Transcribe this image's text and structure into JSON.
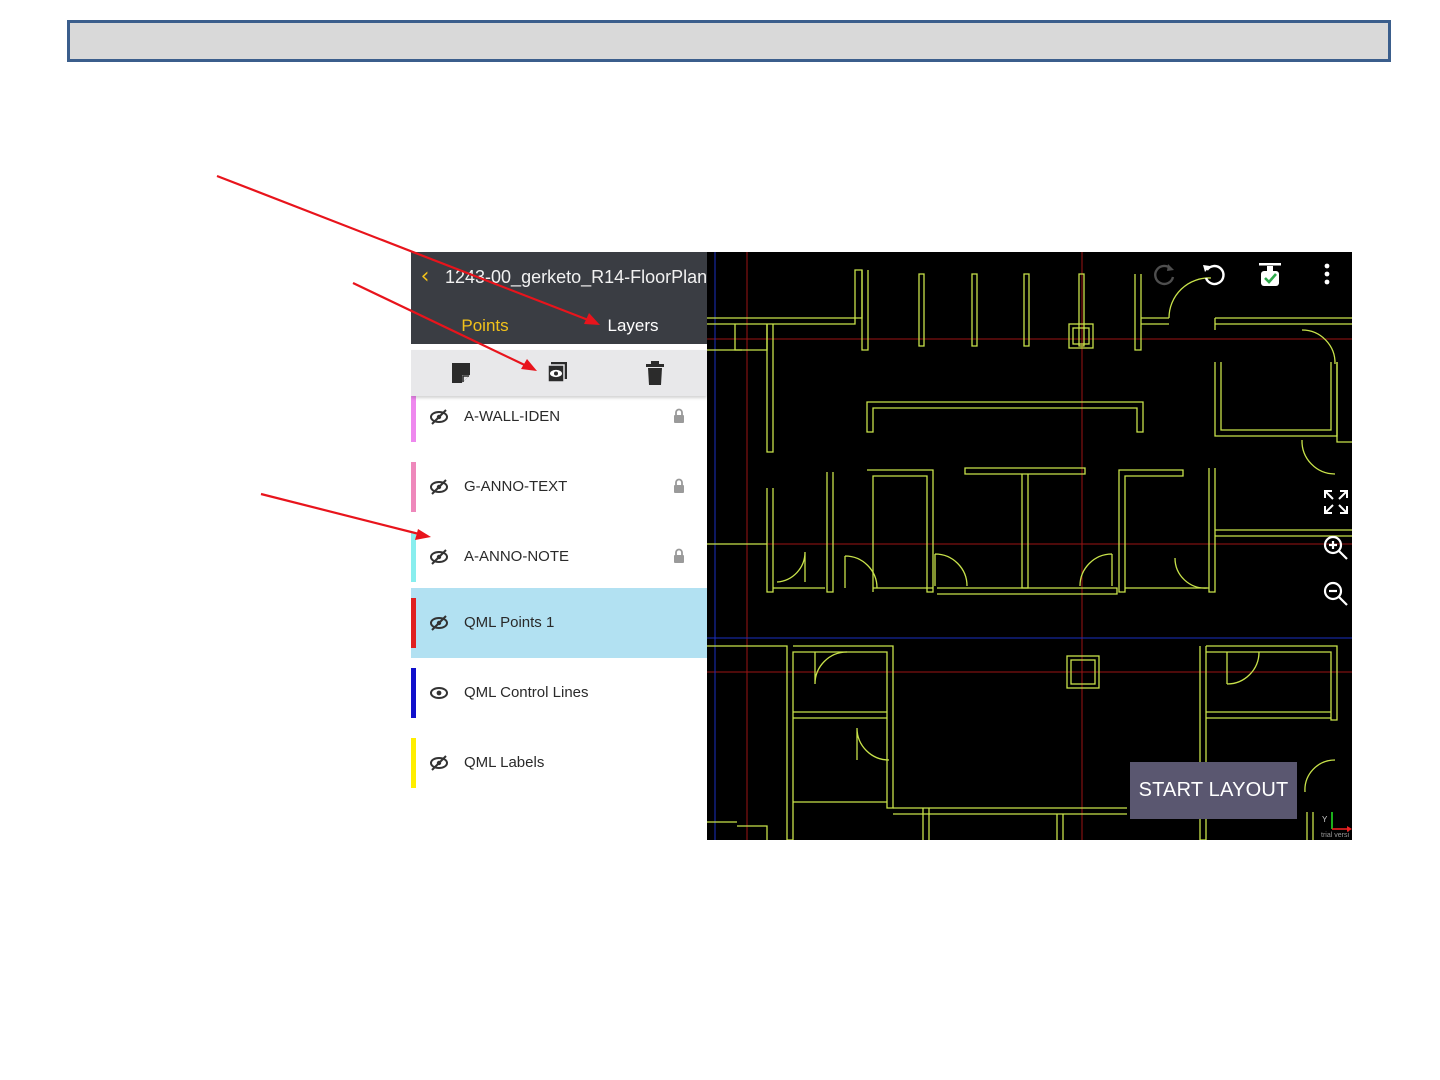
{
  "app": {
    "file_title": "1243-00_gerketo_R14-FloorPlan",
    "back_icon": "chevron-left-icon"
  },
  "tabs": [
    {
      "label": "Points",
      "active": false
    },
    {
      "label": "Layers",
      "active": true
    }
  ],
  "toolbar": {
    "buttons": [
      {
        "icon": "note-icon"
      },
      {
        "icon": "visibility-toggle-icon"
      },
      {
        "icon": "trash-icon"
      }
    ]
  },
  "layers": [
    {
      "name": "",
      "color": "#ffee00",
      "visible": false,
      "locked": true
    },
    {
      "name": "A-WALL-IDEN",
      "color": "#ee88ee",
      "visible": false,
      "locked": true
    },
    {
      "name": "G-ANNO-TEXT",
      "color": "#ee88bb",
      "visible": false,
      "locked": true
    },
    {
      "name": "A-ANNO-NOTE",
      "color": "#88eeee",
      "visible": false,
      "locked": true
    },
    {
      "name": "QML Points 1",
      "color": "#e02020",
      "visible": false,
      "locked": false,
      "selected": true
    },
    {
      "name": "QML Control Lines",
      "color": "#1010cc",
      "visible": true,
      "locked": false
    },
    {
      "name": "QML Labels",
      "color": "#ffee00",
      "visible": false,
      "locked": false
    }
  ],
  "map": {
    "top_tools": [
      "redo-icon",
      "undo-icon",
      "stake-check-icon",
      "more-vert-icon"
    ],
    "side_tools": [
      "fit-extents-icon",
      "zoom-in-icon",
      "zoom-out-icon"
    ],
    "start_button": "START LAYOUT",
    "axis_label": "Y",
    "watermark": "trial versi"
  },
  "colors": {
    "accent": "#f2c21a",
    "header_bg": "#3a3d43",
    "selected_row": "#b2e1f2",
    "title_bar_fill": "#d9d9d9",
    "title_bar_border": "#3b5e8c",
    "annotation_arrow": "#e8141c",
    "wall_line": "#c8e24a"
  }
}
